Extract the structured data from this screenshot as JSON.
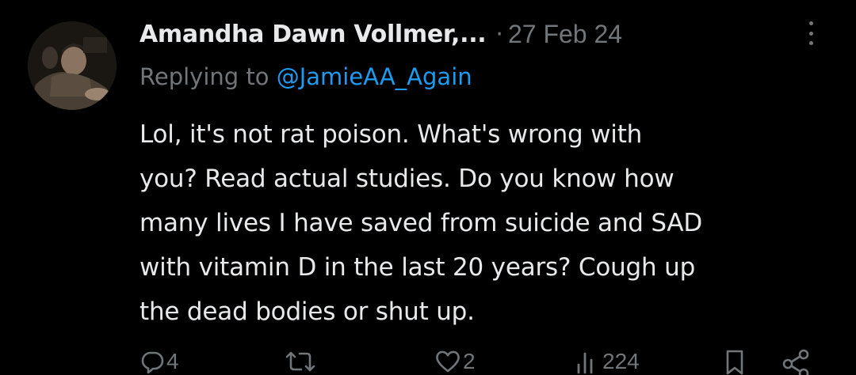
{
  "tweet": {
    "author_name": "Amandha Dawn Vollmer,...",
    "separator": "·",
    "date": "27 Feb 24",
    "reply_prefix": "Replying to ",
    "reply_handle": "@JamieAA_Again",
    "text_lines": [
      "Lol, it's not rat poison. What's wrong with",
      "you? Read actual studies. Do you know how",
      "many lives I have saved from suicide and SAD",
      "with vitamin D in the last 20 years? Cough up",
      "the dead bodies or shut up."
    ]
  },
  "actions": {
    "replies": "4",
    "retweets": "",
    "likes": "2",
    "views": "224"
  },
  "colors": {
    "background": "#000000",
    "text_primary": "#e7e9ea",
    "text_secondary": "#71767b",
    "link": "#1d9bf0"
  },
  "icons": {
    "reply": "reply-icon",
    "retweet": "retweet-icon",
    "like": "heart-icon",
    "views": "bar-chart-icon",
    "bookmark": "bookmark-icon",
    "share": "share-icon",
    "more": "more-vertical-icon"
  }
}
